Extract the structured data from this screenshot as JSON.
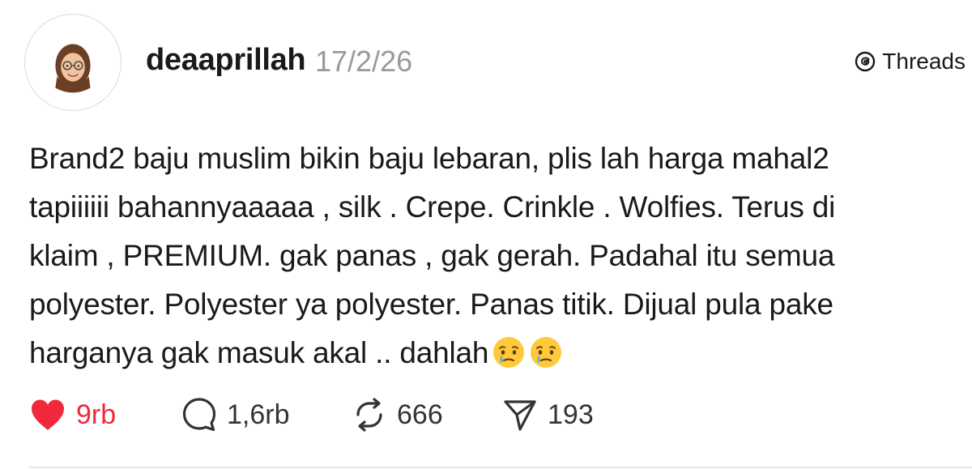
{
  "post": {
    "username": "deaaprillah",
    "timestamp": "17/2/26",
    "platform": "Threads",
    "text_lines": [
      "Brand2 baju muslim bikin baju lebaran, plis lah harga mahal2",
      "tapiiiiii bahannyaaaaa , silk . Crepe. Crinkle . Wolfies. Terus di",
      "klaim , PREMIUM. gak panas , gak gerah. Padahal itu semua",
      "polyester. Polyester ya polyester. Panas titik. Dijual pula pake",
      "harganya gak masuk akal .. dahlah"
    ],
    "trailing_emojis": [
      "face-holding-back-tears",
      "face-holding-back-tears"
    ]
  },
  "actions": {
    "likes": "9rb",
    "replies": "1,6rb",
    "reposts": "666",
    "shares": "193"
  },
  "colors": {
    "like_accent": "#f0283c",
    "timestamp": "#9a9a9a",
    "text": "#1a1a1a"
  },
  "icons": {
    "avatar": "memoji-avatar",
    "brand": "threads-logo-icon",
    "like": "heart-icon",
    "reply": "speech-bubble-icon",
    "repost": "repost-arrows-icon",
    "share": "paper-plane-icon"
  }
}
